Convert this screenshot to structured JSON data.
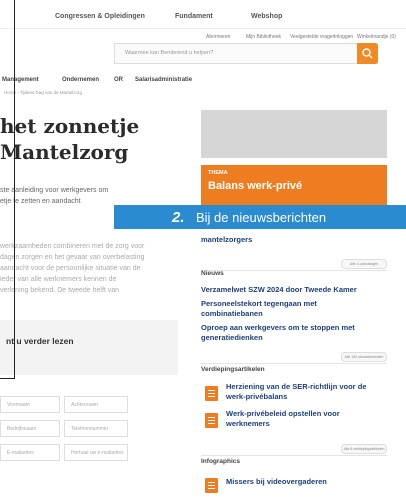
{
  "topnav": {
    "items": [
      "Congressen & Opleidingen",
      "Fundament",
      "Webshop"
    ]
  },
  "utilnav": {
    "items": [
      "Abonneren",
      "Mijn Bibliotheek",
      "Veelgestelde vragen",
      "Inloggen",
      "Winkelmandje (0)"
    ]
  },
  "search": {
    "placeholder": "Waarmee kan Benderend u helpen?"
  },
  "mainnav": {
    "items": [
      "Management",
      "Ondernemen",
      "OR",
      "Salarisadministratie"
    ]
  },
  "breadcrumb": "Home › Tijdens Dag van de Mantelzorg",
  "article": {
    "title_line1": "het zonnetje",
    "title_line2": "Mantelzorg",
    "p1_line1": "ste aanleiding voor werkgevers om",
    "p1_line2": "etje te zetten en aandacht",
    "p2_line1": "werkzaamheden combineren met de zorg voor",
    "p2_line2": "dagen zorgen en het gevaar van overbelasting",
    "p2_line3": "aandacht voor de persoonlijke situatie van de",
    "p2_line4": "ieder van alle werknemers kennen de",
    "p2_line5": "verlening bekend. De tweede helft van"
  },
  "readmore": {
    "title": "nt u verder lezen"
  },
  "form": {
    "placeholders": [
      "Voornaam",
      "Achternaam",
      "Bedrijfsnaam",
      "Telefoonnummer",
      "E-mailadres",
      "Herhaal uw e-mailadres"
    ]
  },
  "side": {
    "box_kicker": "THEMA",
    "box_title": "Balans werk-privé",
    "sub_link": "mantelzorgers",
    "more1": "Alle 4 oplossingen",
    "news_heading": "Nieuws",
    "news": [
      "Verzamelwet SZW 2024 door Tweede Kamer",
      "Personeelstekort tegengaan met",
      "combinatiebanen",
      "Oproep aan werkgevers om te stoppen met",
      "generatiedienken"
    ],
    "more2": "Alle 100 nieuwsberichten",
    "deep_heading": "Verdiepingsartikelen",
    "deep": [
      {
        "line1": "Herziening van de SER-richtlijn voor de",
        "line2": "werk-privébalans"
      },
      {
        "line1": "Werk-privébeleid opstellen voor",
        "line2": "werknemers"
      }
    ],
    "more3": "Alle 6 verdiepingsartikelen",
    "info_heading": "Infographics",
    "info": [
      "Missers bij videovergaderen"
    ]
  },
  "callout": {
    "number": "2.",
    "text": "Bij de nieuwsberichten"
  },
  "colors": {
    "accent": "#ee7d22",
    "callout": "#2a8bd0",
    "link": "#1d3f7a"
  }
}
